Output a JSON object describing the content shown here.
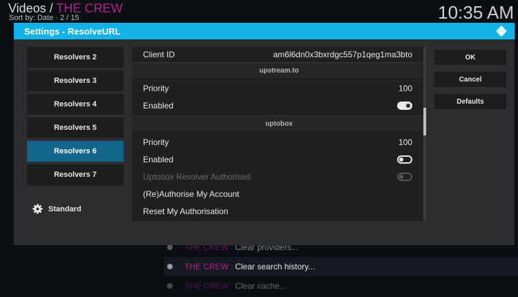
{
  "background": {
    "title_prefix": "Videos",
    "title_separator": "/",
    "title_current": "THE CREW",
    "sort_text": "Sort by: Date",
    "page_text": "2 / 15",
    "clock": "10:35 AM",
    "items": [
      {
        "prefix": "THE CREW",
        "sep": ":",
        "text": "Clear providers..."
      },
      {
        "prefix": "THE CREW",
        "sep": ":",
        "text": "Clear search history..."
      },
      {
        "prefix": "THE CREW",
        "sep": ":",
        "text": "Clear cache..."
      }
    ]
  },
  "dialog": {
    "title": "Settings - ResolveURL",
    "logo_icon": "kodi-logo-icon",
    "accent_color": "#12b2e7",
    "categories": [
      {
        "label": "Resolvers 2"
      },
      {
        "label": "Resolvers 3"
      },
      {
        "label": "Resolvers 4"
      },
      {
        "label": "Resolvers 5"
      },
      {
        "label": "Resolvers 6"
      },
      {
        "label": "Resolvers 7"
      }
    ],
    "selected_category": "Resolvers 6",
    "settings_level": "Standard",
    "settings_level_icon": "gear-icon",
    "settings": [
      {
        "label": "Client ID",
        "value": "am6l6dn0x3bxrdgc557p1qeg1ma3bto"
      },
      {
        "section": "upstream.to"
      },
      {
        "label": "Priority",
        "value": "100"
      },
      {
        "label": "Enabled",
        "toggle": "on"
      },
      {
        "section": "uptobox"
      },
      {
        "label": "Priority",
        "value": "100"
      },
      {
        "label": "Enabled",
        "toggle": "off"
      },
      {
        "label": "Uptobox Resolver Authorised",
        "toggle": "off",
        "disabled": true
      },
      {
        "label": "(Re)Authorise My Account"
      },
      {
        "label": "Reset My Authorisation"
      }
    ],
    "buttons": {
      "ok": "OK",
      "cancel": "Cancel",
      "defaults": "Defaults"
    }
  }
}
